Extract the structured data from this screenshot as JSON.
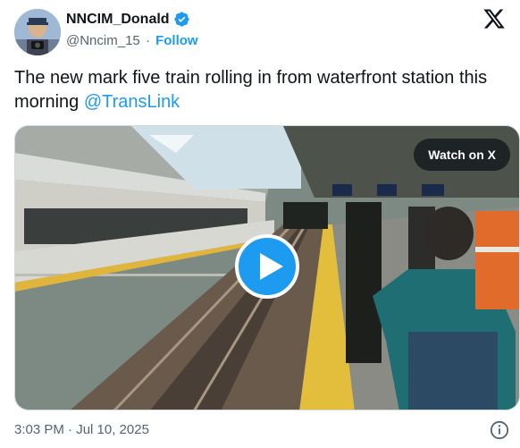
{
  "author": {
    "display_name": "NNCIM_Donald",
    "handle": "@Nncim_15",
    "separator": "·",
    "follow_label": "Follow",
    "verified": true
  },
  "tweet": {
    "text": "The new mark five train rolling in from waterfront station this morning ",
    "mention": "@TransLink"
  },
  "media": {
    "watch_label": "Watch on X",
    "type": "video"
  },
  "footer": {
    "timestamp": "3:03 PM · Jul 10, 2025"
  },
  "colors": {
    "accent": "#1d9bf0",
    "text": "#0f1419",
    "muted": "#536471"
  },
  "icons": [
    "verified-badge-icon",
    "x-logo-icon",
    "play-icon",
    "info-icon"
  ]
}
